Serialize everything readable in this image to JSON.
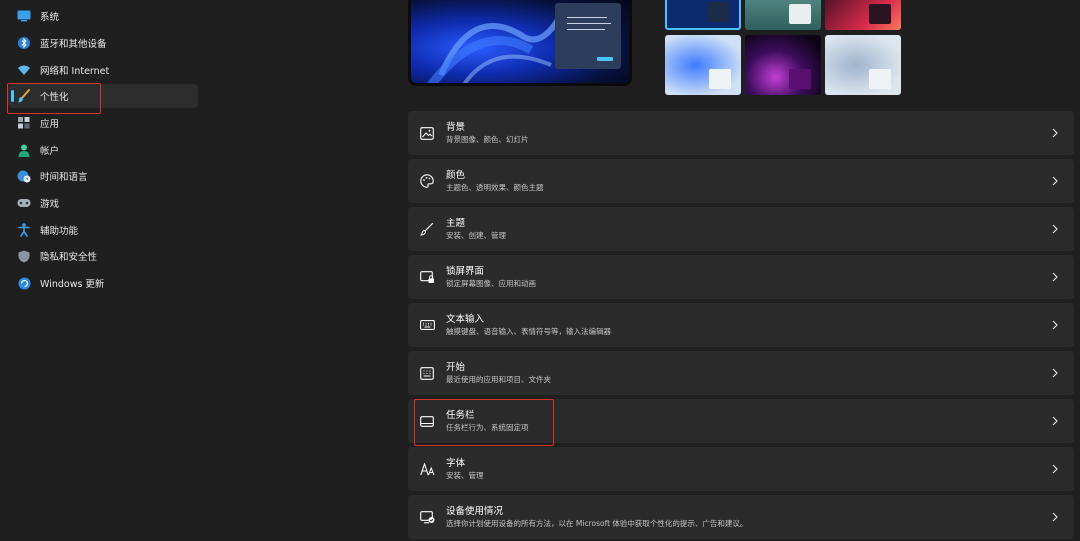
{
  "sidebar": {
    "items": [
      {
        "label": "系统",
        "icon": "monitor-icon"
      },
      {
        "label": "蓝牙和其他设备",
        "icon": "bluetooth-icon"
      },
      {
        "label": "网络和 Internet",
        "icon": "wifi-icon"
      },
      {
        "label": "个性化",
        "icon": "brush-icon",
        "active": true
      },
      {
        "label": "应用",
        "icon": "apps-icon"
      },
      {
        "label": "帐户",
        "icon": "person-icon"
      },
      {
        "label": "时间和语言",
        "icon": "globe-clock-icon"
      },
      {
        "label": "游戏",
        "icon": "gamepad-icon"
      },
      {
        "label": "辅助功能",
        "icon": "accessibility-icon"
      },
      {
        "label": "隐私和安全性",
        "icon": "shield-icon"
      },
      {
        "label": "Windows 更新",
        "icon": "update-icon"
      }
    ]
  },
  "settings": [
    {
      "title": "背景",
      "subtitle": "背景图像、颜色、幻灯片",
      "icon": "picture-icon"
    },
    {
      "title": "颜色",
      "subtitle": "主题色、透明效果、颜色主题",
      "icon": "palette-icon"
    },
    {
      "title": "主题",
      "subtitle": "安装、创建、管理",
      "icon": "brush-icon"
    },
    {
      "title": "锁屏界面",
      "subtitle": "锁定屏幕图像、应用和动画",
      "icon": "lock-screen-icon"
    },
    {
      "title": "文本输入",
      "subtitle": "触摸键盘、语音输入、表情符号等，输入法编辑器",
      "icon": "keyboard-icon"
    },
    {
      "title": "开始",
      "subtitle": "最近使用的应用和项目、文件夹",
      "icon": "start-icon"
    },
    {
      "title": "任务栏",
      "subtitle": "任务栏行为、系统固定项",
      "icon": "taskbar-icon"
    },
    {
      "title": "字体",
      "subtitle": "安装、管理",
      "icon": "font-icon"
    },
    {
      "title": "设备使用情况",
      "subtitle": "选择你计划使用设备的所有方法，以在 Microsoft 体验中获取个性化的提示、广告和建议。",
      "icon": "device-usage-icon"
    }
  ],
  "colors": {
    "accent": "#4cc2ff",
    "highlight_box": "#d9332b",
    "background": "#1f1f1f",
    "card": "#2b2b2b"
  }
}
